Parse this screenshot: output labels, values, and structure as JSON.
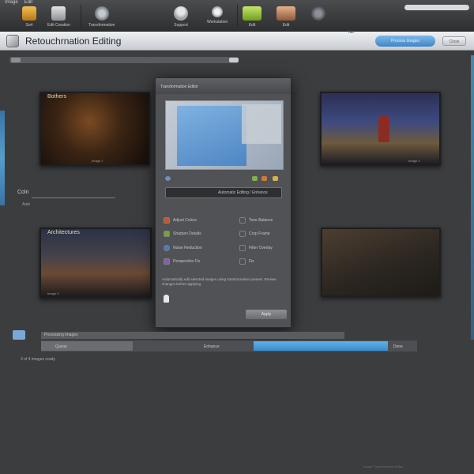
{
  "menu": [
    "Image",
    "Edit"
  ],
  "toolbar": {
    "tools": [
      {
        "label": "Sort",
        "icon": "folder-icon",
        "color": "#d39a2a"
      },
      {
        "label": "Edit Creation",
        "icon": "printer-icon",
        "color": "#a9adb2"
      },
      {
        "label": "Transformation",
        "icon": "gear-icon",
        "color": "#9aa0a6"
      },
      {
        "label": "Support",
        "icon": "person-icon",
        "color": "#cfd2d6"
      },
      {
        "label": "Workstation",
        "icon": "lightbulb-icon",
        "color": "#d9dcdf"
      },
      {
        "label": "Edit",
        "icon": "image-icon",
        "color": "#9ccc3c"
      },
      {
        "label": "Edit",
        "icon": "photo-edit-icon",
        "color": "#c98a5c"
      },
      {
        "label": "",
        "icon": "globe-icon",
        "color": "#7b8187"
      }
    ]
  },
  "title": {
    "app_title": "Retouchrnation Editing",
    "tab_label": "Tab",
    "primary_button": "Process Images",
    "secondary_button": "Close"
  },
  "thumbnails": [
    {
      "caption": "Bothers",
      "mini": "Image 1"
    },
    {
      "caption": "",
      "mini": "Image 2"
    },
    {
      "caption": "Architectures",
      "mini": "Image 3"
    },
    {
      "caption": "",
      "mini": ""
    }
  ],
  "side": {
    "label": "Coln",
    "sub": "Auto"
  },
  "dialog": {
    "title": "Transformation Editor",
    "path": "Automatic Editing / Enhance",
    "options": [
      {
        "label": "Adjust Colors",
        "color": "#c0572f"
      },
      {
        "label": "Sharpen Details",
        "color": "#7aa23a"
      },
      {
        "label": "Noise Reduction",
        "color": "#4a78c4"
      },
      {
        "label": "Perspective Fix",
        "color": "#8a5bb0"
      },
      {
        "label": "Tone Balance",
        "color": "#7b8088"
      },
      {
        "label": "Crop Frame",
        "color": "#7b8088"
      },
      {
        "label": "Filter Overlay",
        "color": "#7b8088"
      },
      {
        "label": "Fix",
        "color": "#7b8088"
      }
    ],
    "note": "Automatically edit selected images using transformation presets. Review changes before applying.",
    "apply_button": "Apply"
  },
  "progress": {
    "label": "Processing Images",
    "left_text": "Queue",
    "mid_text": "Enhance",
    "right_text": "Done",
    "status": "3 of 4 images ready",
    "fill_segments": [
      0.25,
      0.36
    ]
  },
  "footer": "Image Transformation Editor"
}
